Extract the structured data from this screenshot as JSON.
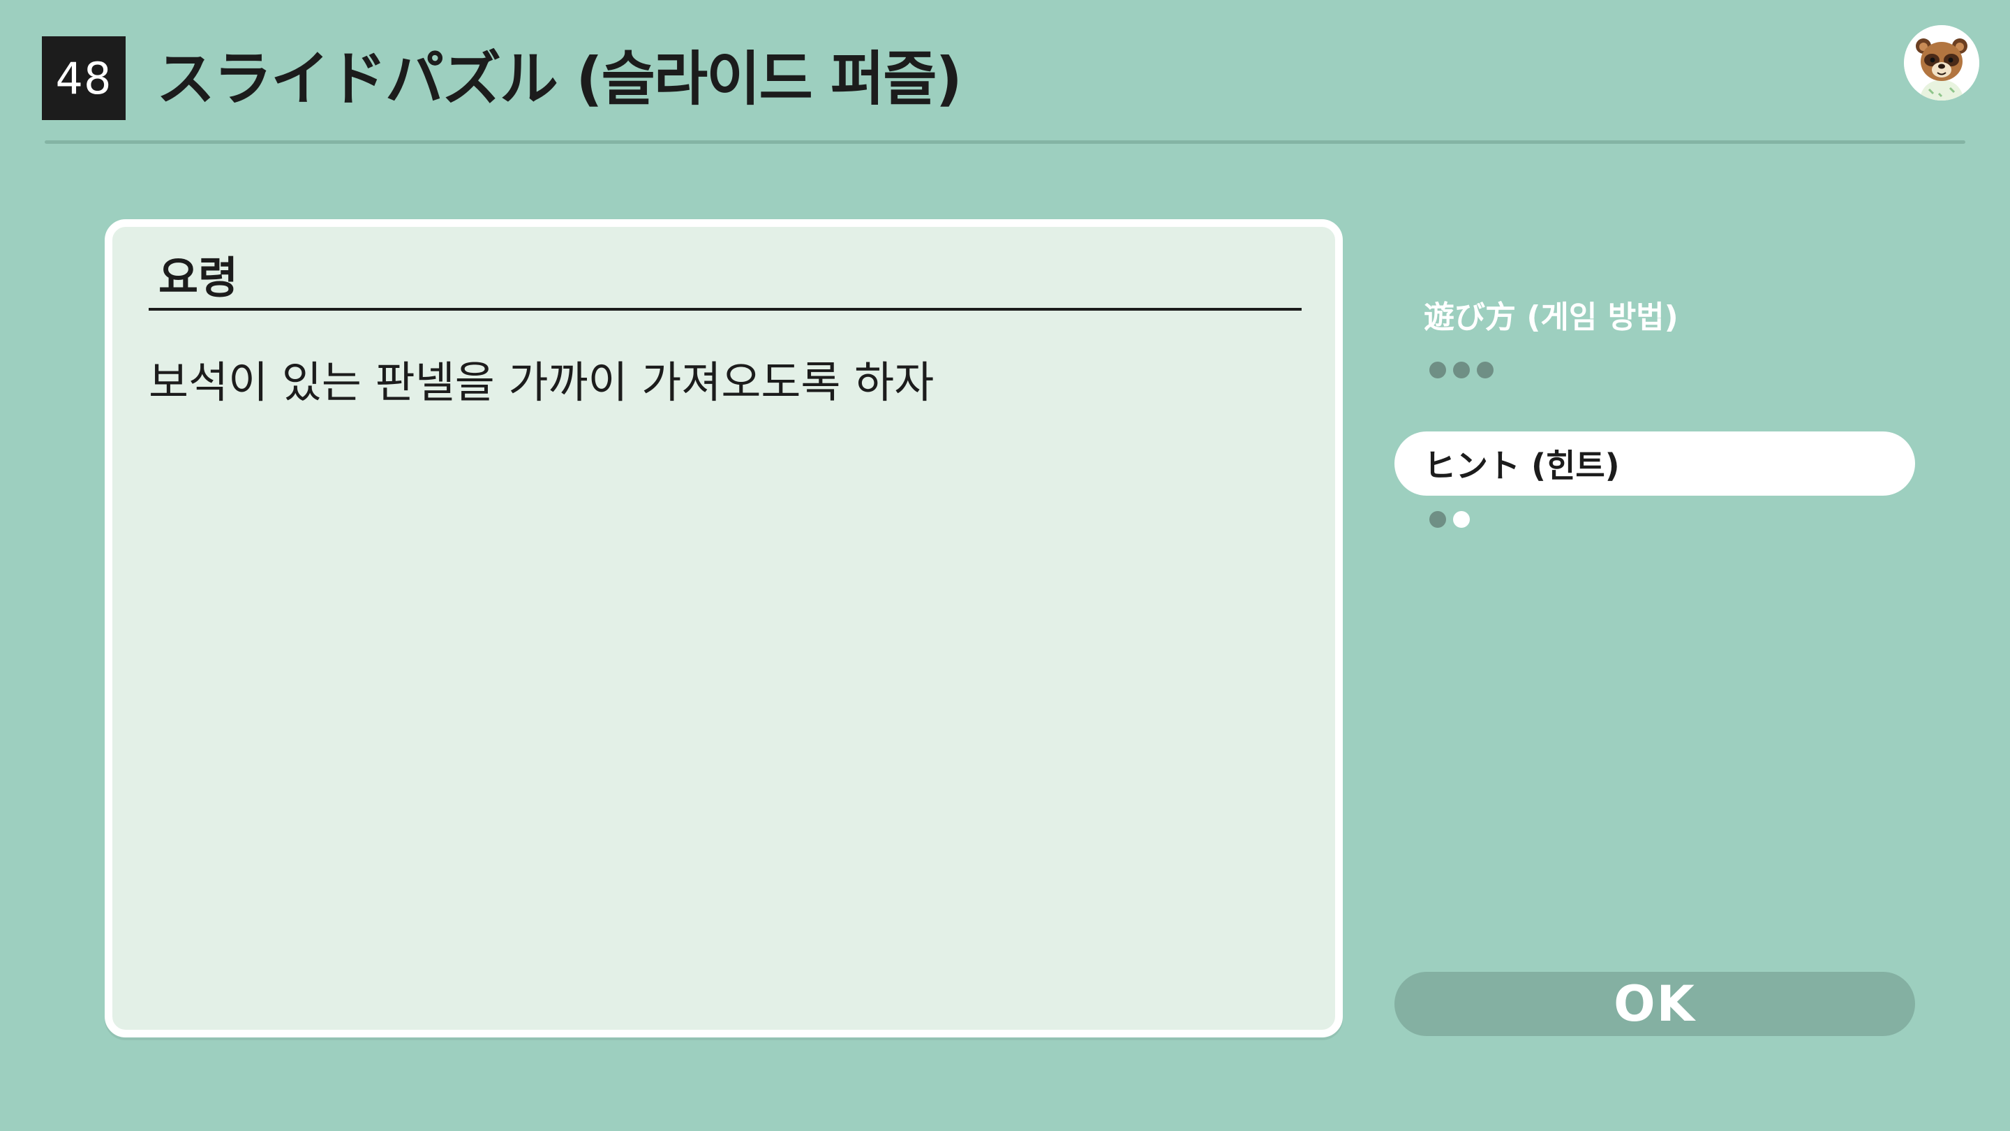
{
  "header": {
    "game_number": "48",
    "title": "スライドパズル (슬라이드 퍼즐)",
    "avatar_icon": "tom-nook-avatar-icon"
  },
  "card": {
    "heading": "요령",
    "body": "보석이 있는 판넬을 가까이 가져오도록 하자"
  },
  "menu": {
    "how_to_play": {
      "label": "遊び方 (게임 방법)",
      "pages_filled": 3,
      "pages_total": 3
    },
    "hint": {
      "label": "ヒント (힌트)",
      "selected": true,
      "pages_filled": 1,
      "pages_total": 2
    }
  },
  "ok_button": {
    "label": "OK"
  },
  "colors": {
    "background": "#9dcfbf",
    "card_fill": "#e3f0e7",
    "card_border": "#ffffff",
    "text_dark": "#1c1c1c",
    "ok_button": "#84b0a2",
    "dot_filled": "#6f8f85"
  }
}
